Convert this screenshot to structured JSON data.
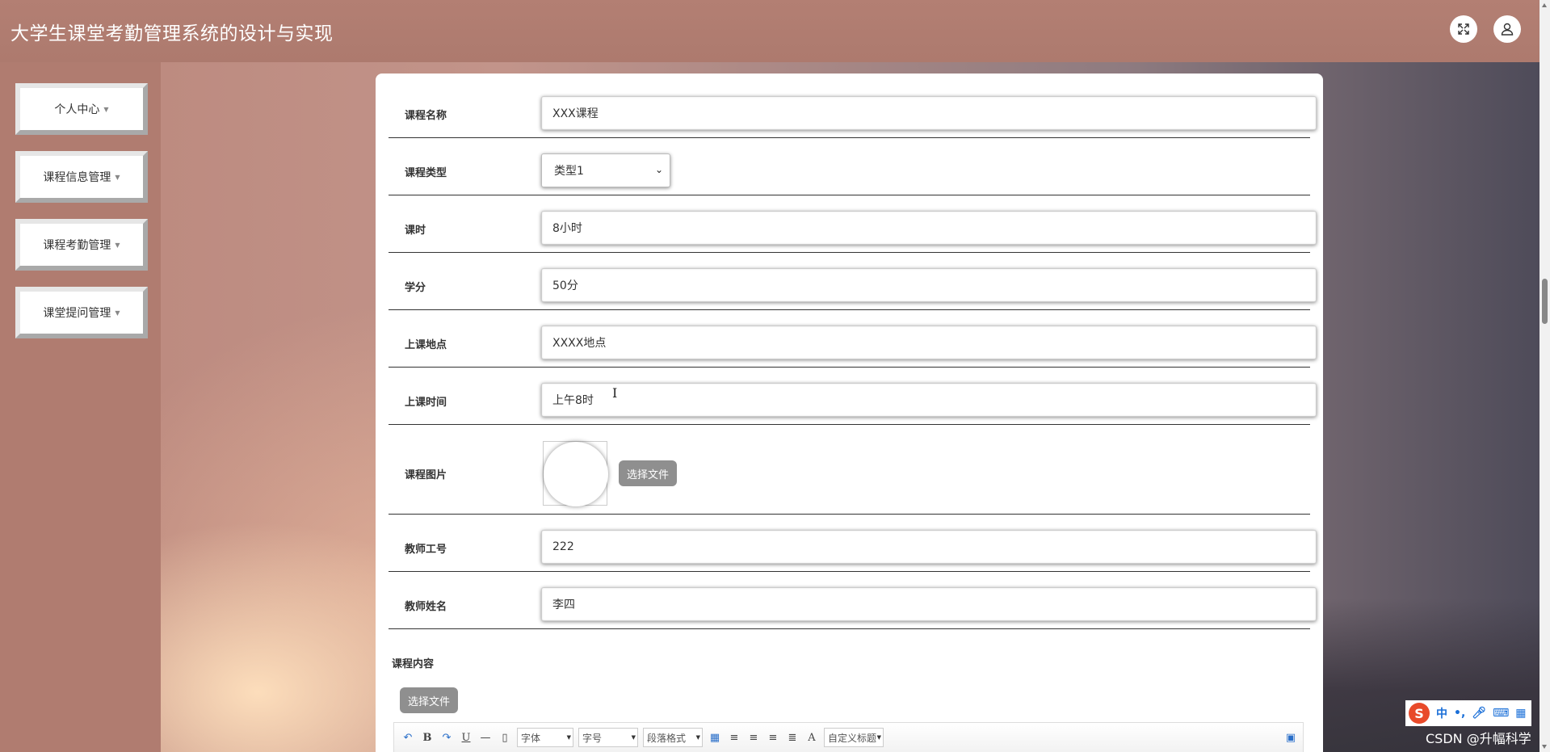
{
  "header": {
    "title": "大学生课堂考勤管理系统的设计与实现",
    "fullscreen_icon": "expand-icon",
    "user_icon": "user-icon"
  },
  "sidebar": {
    "items": [
      {
        "label": "个人中心"
      },
      {
        "label": "课程信息管理"
      },
      {
        "label": "课程考勤管理"
      },
      {
        "label": "课堂提问管理"
      }
    ]
  },
  "form": {
    "course_name": {
      "label": "课程名称",
      "value": "XXX课程"
    },
    "course_type": {
      "label": "课程类型",
      "value": "类型1"
    },
    "hours": {
      "label": "课时",
      "value": "8小时"
    },
    "credits": {
      "label": "学分",
      "value": "50分"
    },
    "location": {
      "label": "上课地点",
      "value": "XXXX地点"
    },
    "time": {
      "label": "上课时间",
      "value": "上午8时"
    },
    "image": {
      "label": "课程图片",
      "button": "选择文件"
    },
    "teacher_id": {
      "label": "教师工号",
      "value": "222"
    },
    "teacher_name": {
      "label": "教师姓名",
      "value": "李四"
    },
    "content": {
      "label": "课程内容",
      "button": "选择文件"
    }
  },
  "editor": {
    "font": "字体",
    "size": "字号",
    "paragraph": "段落格式",
    "custom_title": "自定义标题",
    "font_color": "A"
  },
  "ime": {
    "logo": "S",
    "mode": "中"
  },
  "watermark": "CSDN @升幅科学"
}
